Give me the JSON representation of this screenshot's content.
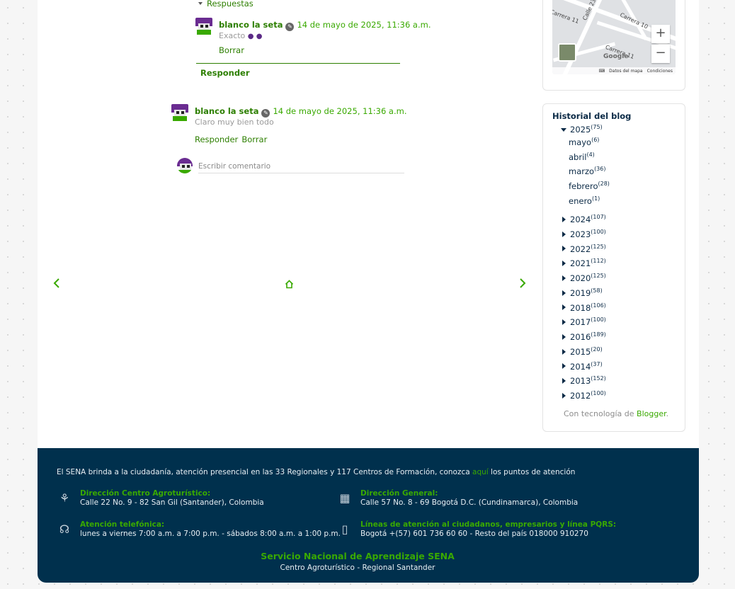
{
  "comments": {
    "replies_toggle": "Respuestas",
    "reply1": {
      "author": "blanco la seta",
      "date": "14 de mayo de 2025, 11:36 a.m.",
      "text": "Exacto",
      "delete": "Borrar"
    },
    "reply_button": "Responder",
    "comment2": {
      "author": "blanco la seta",
      "date": "14 de mayo de 2025, 11:36 a.m.",
      "text": "Claro muy bien todo",
      "reply": "Responder",
      "delete": "Borrar"
    },
    "input_placeholder": "Escribir comentario"
  },
  "nav": {
    "prev_icon": "chevron-left-icon",
    "home_icon": "home-icon",
    "next_icon": "chevron-right-icon"
  },
  "map": {
    "streets": [
      "Carrera 11",
      "Calle 23",
      "Carrera 10",
      "Carrera 11"
    ],
    "zoom_in": "+",
    "zoom_out": "−",
    "logo": "Google",
    "footer_keyboard": "⌨",
    "footer_data": "Datos del mapa",
    "footer_terms": "Condiciones"
  },
  "history": {
    "title": "Historial del blog",
    "expanded_year": {
      "label": "2025",
      "count": "(75)"
    },
    "months": [
      {
        "label": "mayo",
        "count": "(6)"
      },
      {
        "label": "abril",
        "count": "(4)"
      },
      {
        "label": "marzo",
        "count": "(36)"
      },
      {
        "label": "febrero",
        "count": "(28)"
      },
      {
        "label": "enero",
        "count": "(1)"
      }
    ],
    "years": [
      {
        "label": "2024",
        "count": "(107)"
      },
      {
        "label": "2023",
        "count": "(100)"
      },
      {
        "label": "2022",
        "count": "(125)"
      },
      {
        "label": "2021",
        "count": "(112)"
      },
      {
        "label": "2020",
        "count": "(125)"
      },
      {
        "label": "2019",
        "count": "(58)"
      },
      {
        "label": "2018",
        "count": "(106)"
      },
      {
        "label": "2017",
        "count": "(100)"
      },
      {
        "label": "2016",
        "count": "(189)"
      },
      {
        "label": "2015",
        "count": "(20)"
      },
      {
        "label": "2014",
        "count": "(37)"
      },
      {
        "label": "2013",
        "count": "(152)"
      },
      {
        "label": "2012",
        "count": "(100)"
      }
    ],
    "powered_text": "Con tecnología de",
    "powered_link": "Blogger",
    "powered_end": "."
  },
  "footer": {
    "intro_pre": "El SENA brinda a la ciudadanía, atención presencial en las 33 Regionales y 117 Centros de Formación, conozca",
    "intro_link": "aquí",
    "intro_post": "los puntos de atención",
    "items": [
      {
        "head": "Dirección Centro Agroturístico:",
        "body": "Calle 22 No. 9 - 82 San Gil (Santander), Colombia"
      },
      {
        "head": "Dirección General:",
        "body": "Calle 57 No. 8 - 69 Bogotá D.C. (Cundinamarca), Colombia"
      },
      {
        "head": "Atención telefónica:",
        "body": "lunes a viernes 7:00 a.m. a 7:00 p.m. - sábados 8:00 a.m. a 1:00 p.m."
      },
      {
        "head": "Líneas de atención al ciudadanos, empresarios y línea PQRS:",
        "body": "Bogotá +(57) 601 736 60 60 - Resto del país 018000 910270"
      }
    ],
    "org": "Servicio Nacional de Aprendizaje SENA",
    "center": "Centro Agroturístico - Regional Santander"
  },
  "colors": {
    "accent_green": "#39a900",
    "footer_bg": "#00304d",
    "text_dark": "#0b2a46"
  }
}
